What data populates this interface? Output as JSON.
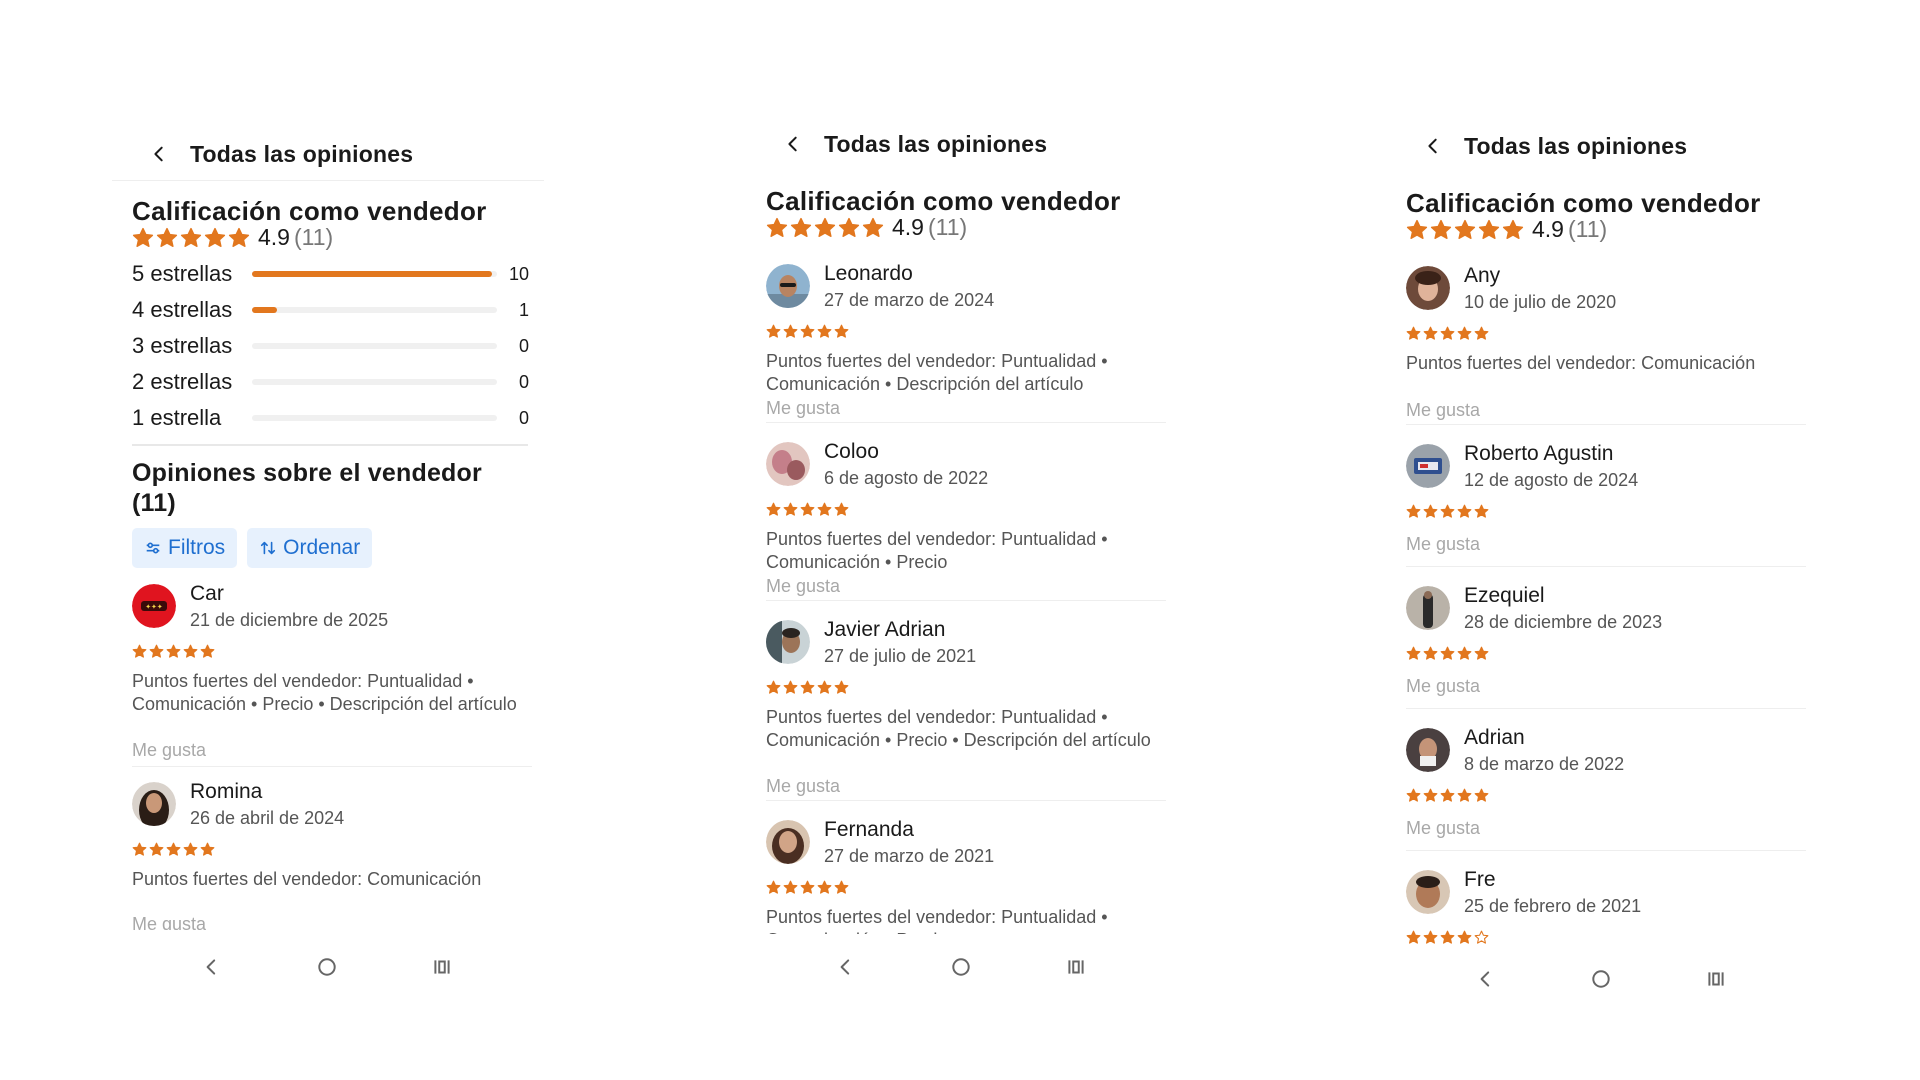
{
  "colors": {
    "star": "#e2771e",
    "link": "#1f6fd0",
    "chip_bg": "#e7f1fd"
  },
  "screens": [
    {
      "header": {
        "back_icon": "chevron-left-icon",
        "title": "Todas las opiniones"
      },
      "rating": {
        "title": "Calificación como vendedor",
        "value": "4.9",
        "count": "(11)",
        "stars": 5
      },
      "histogram": [
        {
          "label": "5 estrellas",
          "count": "10",
          "fraction": 0.98
        },
        {
          "label": "4 estrellas",
          "count": "1",
          "fraction": 0.1
        },
        {
          "label": "3 estrellas",
          "count": "0",
          "fraction": 0
        },
        {
          "label": "2 estrellas",
          "count": "0",
          "fraction": 0
        },
        {
          "label": "1 estrella",
          "count": "0",
          "fraction": 0
        }
      ],
      "opinions_title": "Opiniones sobre el vendedor (11)",
      "chips": {
        "filters": "Filtros",
        "sort": "Ordenar",
        "filters_icon": "sliders-icon",
        "sort_icon": "sort-arrows-icon"
      },
      "reviews": [
        {
          "name": "Car",
          "date": "21 de diciembre de 2025",
          "stars": 5,
          "text": "Puntos fuertes del vendedor: Puntualidad • Comunicación • Precio • Descripción del artículo",
          "like": "Me gusta"
        },
        {
          "name": "Romina",
          "date": "26 de abril de 2024",
          "stars": 5,
          "text": "Puntos fuertes del vendedor: Comunicación",
          "like": "Me gusta"
        }
      ],
      "nav": {
        "back": "nav-back-icon",
        "home": "nav-home-icon",
        "recents": "nav-recents-icon"
      }
    },
    {
      "header": {
        "back_icon": "chevron-left-icon",
        "title": "Todas las opiniones"
      },
      "rating": {
        "title": "Calificación como vendedor",
        "value": "4.9",
        "count": "(11)",
        "stars": 5
      },
      "reviews": [
        {
          "name": "Leonardo",
          "date": "27 de marzo de 2024",
          "stars": 5,
          "text": "Puntos fuertes del vendedor: Puntualidad • Comunicación • Descripción del artículo",
          "like": "Me gusta"
        },
        {
          "name": "Coloo",
          "date": "6 de agosto de 2022",
          "stars": 5,
          "text": "Puntos fuertes del vendedor: Puntualidad • Comunicación • Precio",
          "like": "Me gusta"
        },
        {
          "name": "Javier Adrian",
          "date": "27 de julio de 2021",
          "stars": 5,
          "text": "Puntos fuertes del vendedor: Puntualidad • Comunicación • Precio • Descripción del artículo",
          "like": "Me gusta"
        },
        {
          "name": "Fernanda",
          "date": "27 de marzo de 2021",
          "stars": 5,
          "text": "Puntos fuertes del vendedor: Puntualidad • Comunicación • Precio",
          "like": ""
        }
      ],
      "nav": {
        "back": "nav-back-icon",
        "home": "nav-home-icon",
        "recents": "nav-recents-icon"
      }
    },
    {
      "header": {
        "back_icon": "chevron-left-icon",
        "title": "Todas las opiniones"
      },
      "rating": {
        "title": "Calificación como vendedor",
        "value": "4.9",
        "count": "(11)",
        "stars": 5
      },
      "reviews": [
        {
          "name": "Any",
          "date": "10 de julio de 2020",
          "stars": 5,
          "text": "Puntos fuertes del vendedor: Comunicación",
          "like": "Me gusta"
        },
        {
          "name": "Roberto Agustin",
          "date": "12 de agosto de 2024",
          "stars": 5,
          "text": "",
          "like": "Me gusta"
        },
        {
          "name": "Ezequiel",
          "date": "28 de diciembre de 2023",
          "stars": 5,
          "text": "",
          "like": "Me gusta"
        },
        {
          "name": "Adrian",
          "date": "8 de marzo de 2022",
          "stars": 5,
          "text": "",
          "like": "Me gusta"
        },
        {
          "name": "Fre",
          "date": "25 de febrero de 2021",
          "stars": 4,
          "text": "",
          "like": ""
        }
      ],
      "nav": {
        "back": "nav-back-icon",
        "home": "nav-home-icon",
        "recents": "nav-recents-icon"
      }
    }
  ]
}
